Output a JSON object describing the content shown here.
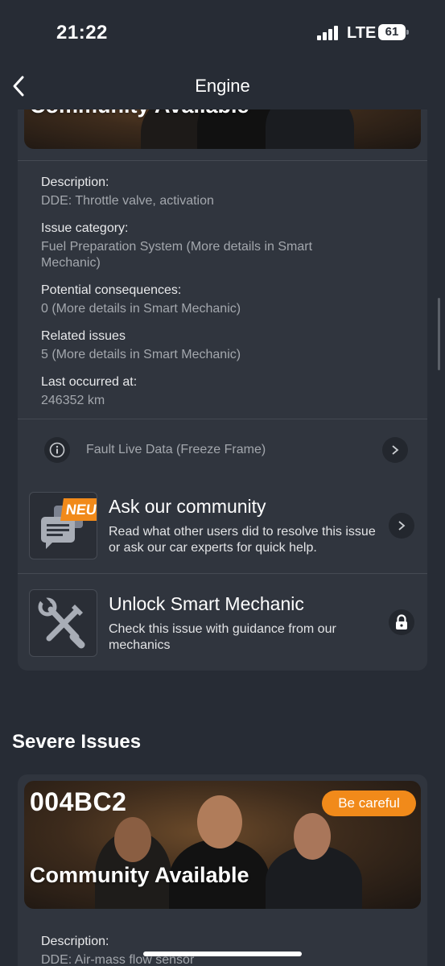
{
  "status_bar": {
    "time": "21:22",
    "network": "LTE",
    "battery": "61"
  },
  "nav": {
    "title": "Engine",
    "back_icon": "chevron-left-icon"
  },
  "issue_card": {
    "banner_title": "Community Available",
    "fields": [
      {
        "label": "Description:",
        "value": "DDE: Throttle valve, activation"
      },
      {
        "label": "Issue category:",
        "value": "Fuel Preparation System (More details in Smart Mechanic)"
      },
      {
        "label": "Potential consequences:",
        "value": "0 (More details in Smart Mechanic)"
      },
      {
        "label": "Related issues",
        "value": "5 (More details in Smart Mechanic)"
      },
      {
        "label": "Last occurred at:",
        "value": "246352 km"
      }
    ],
    "live_data_label": "Fault Live Data (Freeze Frame)",
    "community": {
      "badge": "NEU",
      "title": "Ask our community",
      "description": "Read what other users did to resolve this issue or ask our car experts for quick help."
    },
    "smart_mechanic": {
      "title": "Unlock Smart Mechanic",
      "description": "Check this issue with guidance from our mechanics"
    }
  },
  "severe_section": {
    "title": "Severe Issues",
    "card": {
      "code": "004BC2",
      "badge": "Be careful",
      "banner_title": "Community Available",
      "field_label": "Description:",
      "field_value": "DDE: Air-mass flow sensor"
    }
  },
  "colors": {
    "background": "#272c35",
    "card": "#30353e",
    "accent": "#f18a1a"
  }
}
